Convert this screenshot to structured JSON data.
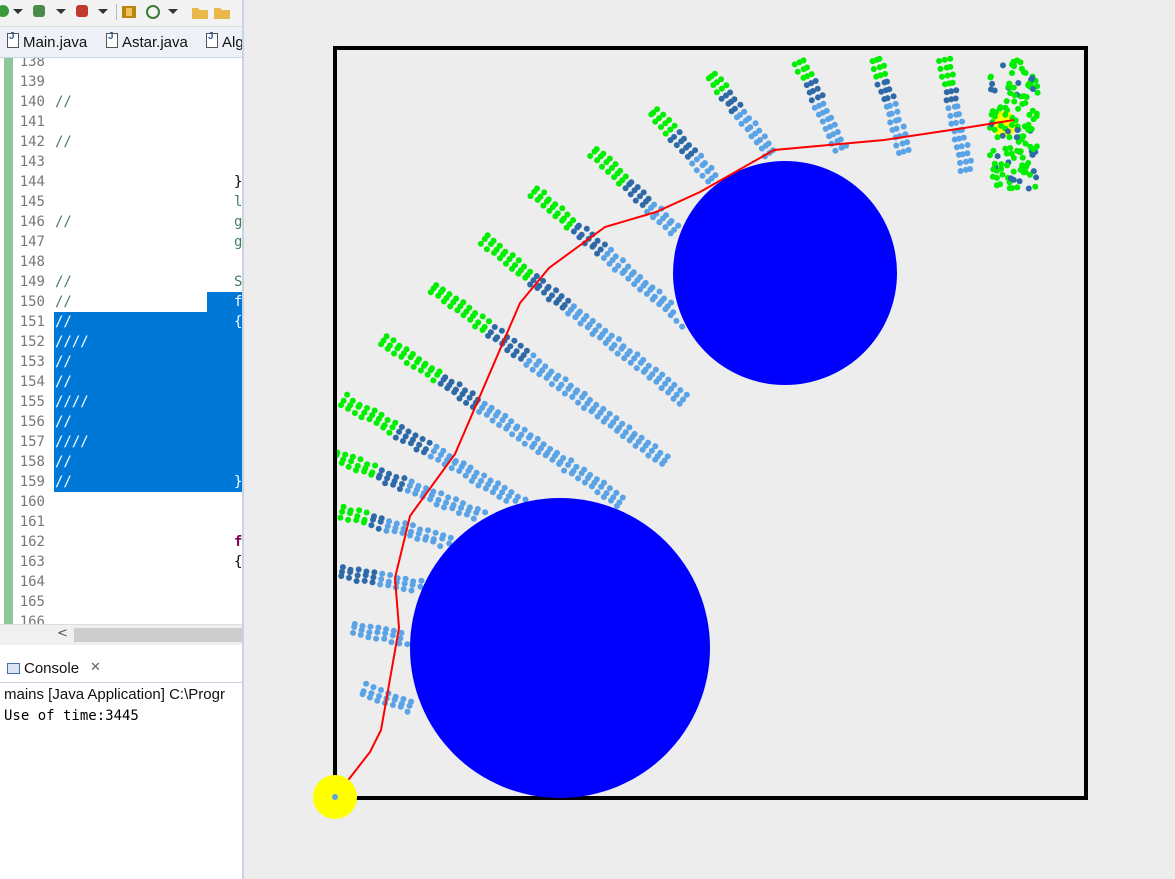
{
  "ide": {
    "tabs": [
      "Main.java",
      "Astar.java",
      "Alg"
    ],
    "code_lines": [
      {
        "n": "138",
        "left": "",
        "right": ""
      },
      {
        "n": "139",
        "left": "",
        "right": ""
      },
      {
        "n": "140",
        "left": "//",
        "right": ""
      },
      {
        "n": "141",
        "left": "",
        "right": ""
      },
      {
        "n": "142",
        "left": "//",
        "right": ""
      },
      {
        "n": "143",
        "left": "",
        "right": ""
      },
      {
        "n": "144",
        "left": "",
        "right": "}"
      },
      {
        "n": "145",
        "left": "",
        "right": "l"
      },
      {
        "n": "146",
        "left": "//",
        "right": "g"
      },
      {
        "n": "147",
        "left": "",
        "right": "g"
      },
      {
        "n": "148",
        "left": "",
        "right": ""
      },
      {
        "n": "149",
        "left": "//",
        "right": "S"
      },
      {
        "n": "150",
        "left": "//",
        "right": "f"
      },
      {
        "n": "151",
        "left": "//",
        "right": "{"
      },
      {
        "n": "152",
        "left": "////",
        "right": ""
      },
      {
        "n": "153",
        "left": "//",
        "right": ""
      },
      {
        "n": "154",
        "left": "//",
        "right": ""
      },
      {
        "n": "155",
        "left": "////",
        "right": ""
      },
      {
        "n": "156",
        "left": "//",
        "right": ""
      },
      {
        "n": "157",
        "left": "////",
        "right": ""
      },
      {
        "n": "158",
        "left": "//",
        "right": ""
      },
      {
        "n": "159",
        "left": "//",
        "right": "}"
      },
      {
        "n": "160",
        "left": "",
        "right": ""
      },
      {
        "n": "161",
        "left": "",
        "right": ""
      },
      {
        "n": "162",
        "left": "",
        "right": "f"
      },
      {
        "n": "163",
        "left": "",
        "right": "{"
      },
      {
        "n": "164",
        "left": "",
        "right": ""
      },
      {
        "n": "165",
        "left": "",
        "right": ""
      },
      {
        "n": "166",
        "left": "",
        "right": ""
      }
    ],
    "console": {
      "tab_label": "Console",
      "close_glyph": "✕",
      "description": "mains [Java Application] C:\\Progr",
      "output": "Use of time:3445"
    },
    "scroll_left_glyph": "<"
  },
  "colors": {
    "obstacle": "#0000ff",
    "path": "#ff0000",
    "endpoint": "#ffff00",
    "explored_green": "#00ee00",
    "explored_dark": "#2f6aa8",
    "explored_light": "#5aa3e6",
    "boundary": "#000000",
    "background": "#ededed",
    "selection": "#0078d7"
  },
  "icons": [
    "run-icon",
    "debug-icon",
    "coverage-icon",
    "package-icon",
    "refresh-icon",
    "open-folder-icon",
    "java-file-icon",
    "console-icon",
    "close-icon"
  ]
}
